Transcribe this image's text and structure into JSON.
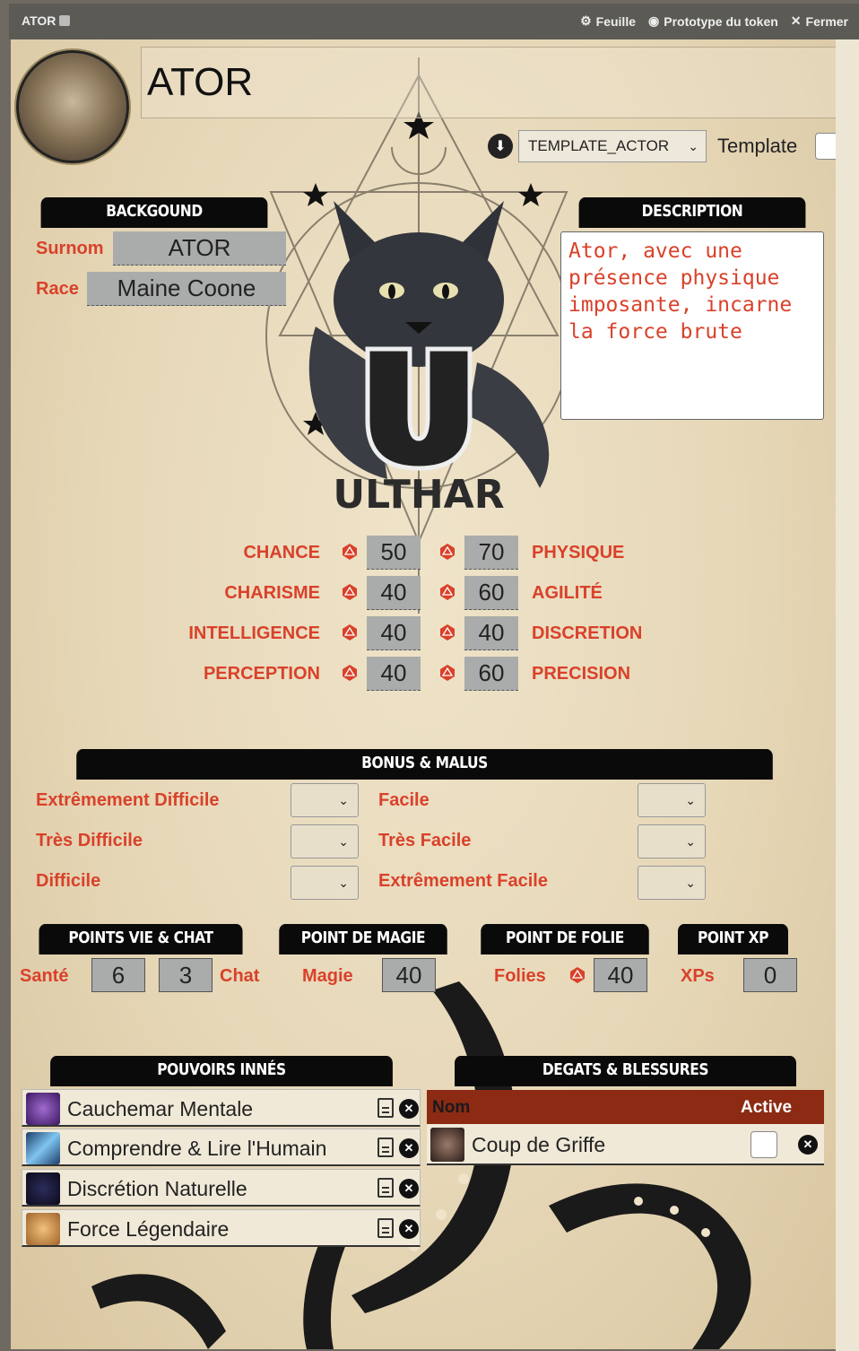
{
  "titlebar": {
    "title": "ATOR",
    "actions": [
      {
        "icon": "gear-icon",
        "label": "Feuille"
      },
      {
        "icon": "user-circle-icon",
        "label": "Prototype du token"
      },
      {
        "icon": "close-icon",
        "label": "Fermer"
      }
    ]
  },
  "header": {
    "name": "ATOR",
    "template_select": "TEMPLATE_ACTOR",
    "template_label": "Template"
  },
  "background": {
    "title": "BACKGOUND",
    "surnom_label": "Surnom",
    "surnom_value": "ATOR",
    "race_label": "Race",
    "race_value": "Maine Coone"
  },
  "description": {
    "title": "DESCRIPTION",
    "text": "Ator, avec une présence physique imposante, incarne la force brute"
  },
  "logo_text": "ULTHAR",
  "stats": {
    "left": [
      {
        "label": "CHANCE",
        "value": "50"
      },
      {
        "label": "CHARISME",
        "value": "40"
      },
      {
        "label": "INTELLIGENCE",
        "value": "40"
      },
      {
        "label": "PERCEPTION",
        "value": "40"
      }
    ],
    "right": [
      {
        "label": "PHYSIQUE",
        "value": "70"
      },
      {
        "label": "AGILITÉ",
        "value": "60"
      },
      {
        "label": "DISCRETION",
        "value": "40"
      },
      {
        "label": "PRECISION",
        "value": "60"
      }
    ]
  },
  "bonus": {
    "title": "BONUS & MALUS",
    "left": [
      "Extrêmement Difficile",
      "Très Difficile",
      "Difficile"
    ],
    "right": [
      "Facile",
      "Très Facile",
      "Extrêmement Facile"
    ]
  },
  "points": {
    "vie_title": "POINTS VIE & CHAT",
    "magie_title": "POINT DE MAGIE",
    "folie_title": "POINT DE FOLIE",
    "xp_title": "POINT XP",
    "sante_label": "Santé",
    "sante_value": "6",
    "chat_value": "3",
    "chat_label": "Chat",
    "magie_label": "Magie",
    "magie_value": "40",
    "folies_label": "Folies",
    "folies_value": "40",
    "xp_label": "XPs",
    "xp_value": "0"
  },
  "pouvoirs": {
    "title": "POUVOIRS INNÉS",
    "items": [
      "Cauchemar Mentale",
      "Comprendre & Lire l'Humain",
      "Discrétion Naturelle",
      "Force Légendaire"
    ]
  },
  "degats": {
    "title": "DEGATS & BLESSURES",
    "col_nom": "Nom",
    "col_active": "Active",
    "items": [
      "Coup de Griffe"
    ]
  },
  "colors": {
    "accent": "#d9412a",
    "header_bg": "#0a0a0a",
    "degats_header": "#8c2a14"
  }
}
